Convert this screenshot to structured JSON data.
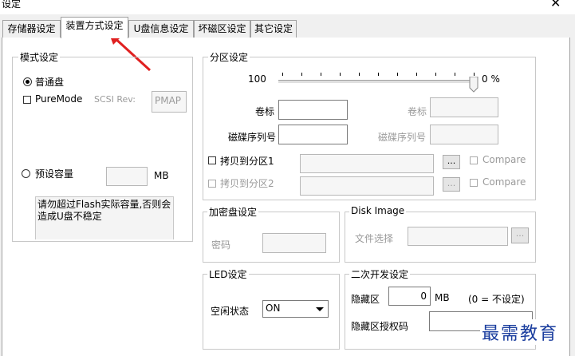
{
  "window": {
    "title": "设定",
    "close_glyph": "✕"
  },
  "tabs": [
    {
      "label": "存储器设定",
      "selected": false
    },
    {
      "label": "装置方式设定",
      "selected": true
    },
    {
      "label": "U盘信息设定",
      "selected": false
    },
    {
      "label": "坏磁区设定",
      "selected": false
    },
    {
      "label": "其它设定",
      "selected": false
    }
  ],
  "mode_group": {
    "title": "模式设定",
    "normal_disk_label": "普通盘",
    "puremode_label": "PureMode",
    "scsi_rev_label": "SCSI Rev:",
    "scsi_rev_value": "PMAP",
    "preset_capacity_label": "预设容量",
    "preset_capacity_unit": "MB",
    "preset_capacity_value": "",
    "note_text": "请勿超过Flash实际容量,否则会造成U盘不稳定"
  },
  "partition_group": {
    "title": "分区设定",
    "slider_left_value": "100",
    "slider_right_value": "0 %",
    "volume_label_1": "卷标",
    "volume_label_2": "卷标",
    "disk_serial_1": "磁碟序列号",
    "disk_serial_2": "磁碟序列号",
    "copy_to_p1": "拷贝到分区1",
    "copy_to_p2": "拷贝到分区2",
    "browse": "...",
    "compare": "Compare"
  },
  "encrypt_group": {
    "title": "加密盘设定",
    "password_label": "密码"
  },
  "disk_image_group": {
    "title": "Disk Image",
    "file_select_label": "文件选择",
    "browse": "..."
  },
  "led_group": {
    "title": "LED设定",
    "idle_state_label": "空闲状态",
    "idle_state_value": "ON"
  },
  "dev_group": {
    "title": "二次开发设定",
    "hidden_area_label": "隐藏区",
    "hidden_area_value": "0",
    "hidden_area_unit": "MB",
    "hidden_area_hint": "(0 = 不设定)",
    "hidden_auth_label": "隐藏区授权码",
    "hidden_auth_value": ""
  },
  "annotation": {
    "arrow_color": "#e02020"
  },
  "watermark": {
    "text": "最需教育"
  }
}
